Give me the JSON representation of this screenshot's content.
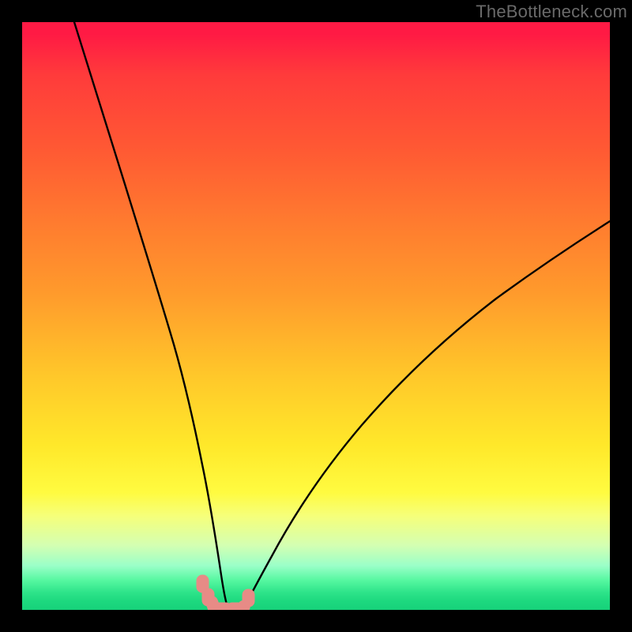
{
  "watermark": {
    "text": "TheBottleneck.com"
  },
  "chart_data": {
    "type": "line",
    "title": "",
    "xlabel": "",
    "ylabel": "",
    "xlim": [
      0,
      100
    ],
    "ylim": [
      0,
      100
    ],
    "grid": false,
    "legend": false,
    "series": [
      {
        "name": "left-branch",
        "x": [
          9,
          11,
          13,
          15,
          17,
          19,
          21,
          23,
          25,
          27,
          28.5,
          30,
          31.4,
          33,
          34
        ],
        "y": [
          100,
          92,
          84,
          76,
          67,
          58,
          49,
          40,
          30.5,
          20.5,
          13,
          6.5,
          2,
          0.3,
          0
        ]
      },
      {
        "name": "right-branch",
        "x": [
          37.5,
          38,
          40,
          42.5,
          45.5,
          50,
          55,
          60,
          66,
          73,
          80,
          88,
          94,
          100
        ],
        "y": [
          0,
          0.4,
          3.5,
          8,
          13.5,
          21,
          28.5,
          35,
          41.5,
          48.5,
          54.5,
          60.5,
          64.5,
          68.5
        ]
      }
    ],
    "markers": {
      "name": "optimal-zone",
      "color": "#e78b86",
      "points": [
        {
          "x": 30.5,
          "y": 4.6
        },
        {
          "x": 31.4,
          "y": 2.3
        },
        {
          "x": 32.2,
          "y": 0.9
        },
        {
          "x": 33.4,
          "y": 0.3
        },
        {
          "x": 35.6,
          "y": 0.3
        },
        {
          "x": 37.4,
          "y": 0.7
        },
        {
          "x": 38.4,
          "y": 1.9
        }
      ]
    },
    "background_gradient": {
      "top": "#ff1a44",
      "mid": "#ffe82a",
      "bottom": "#17d17a"
    }
  }
}
